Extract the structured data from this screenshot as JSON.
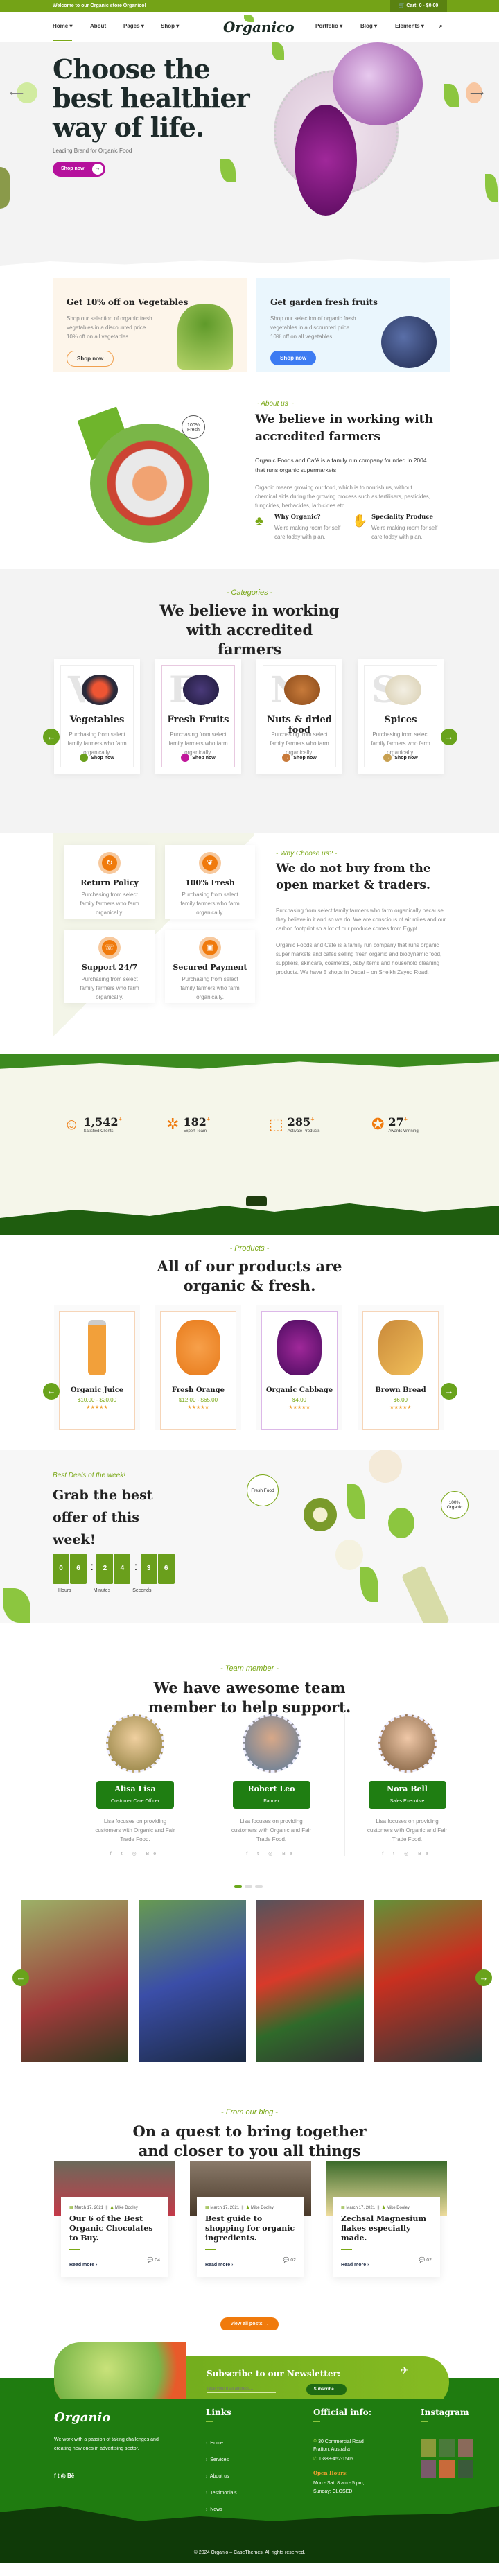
{
  "topbar": {
    "welcome": "Welcome to our Organic store Organico!",
    "cart": "Cart: 0 - $0.00",
    "cart_icon": "cart-icon"
  },
  "header": {
    "logo": "Organico",
    "nav_left": [
      "Home",
      "About",
      "Pages",
      "Shop"
    ],
    "nav_right": [
      "Portfolio",
      "Blog",
      "Elements"
    ],
    "dropdown": [
      "Home",
      "Pages",
      "Shop",
      "Portfolio",
      "Blog",
      "Elements"
    ],
    "active": "Home",
    "search_icon": "search-icon"
  },
  "hero": {
    "title": "Choose the best healthier way of life.",
    "subtitle": "Leading Brand for Organic Food",
    "cta": "Shop now",
    "prev_icon": "arrow-left-icon",
    "next_icon": "arrow-right-icon"
  },
  "promos": [
    {
      "title": "Get 10% off on Vegetables",
      "text": "Shop our selection of organic fresh vegetables in a discounted price. 10% off on all vegetables.",
      "button": "Shop now"
    },
    {
      "title": "Get garden fresh fruits",
      "text": "Shop our selection of organic fresh vegetables in a discounted price. 10% off on all vegetables.",
      "button": "Shop now"
    }
  ],
  "about": {
    "badge": "100% Fresh",
    "eyebrow": "~ About us ~",
    "title": "We believe in working with accredited farmers",
    "lead": "Organic Foods and Café is a family run company founded in 2004 that runs organic supermarkets",
    "text": "Organic means growing our food, which is to nourish us, without chemical aids during the growing process such as fertilisers, pesticides, fungcides, herbacides, larbicides etc",
    "features": [
      {
        "title": "Why Organic?",
        "text": "We're making room for self care today with plan."
      },
      {
        "title": "Speciality Produce",
        "text": "We're making room for self care today with plan."
      }
    ]
  },
  "categories": {
    "eyebrow": "- Categories -",
    "title": "We believe in working with accredited farmers",
    "items": [
      {
        "letter": "V",
        "name": "Vegetables",
        "text": "Purchasing from select family farmers who farm organically.",
        "cta": "Shop now",
        "color": "#6a9f1c"
      },
      {
        "letter": "F",
        "name": "Fresh Fruits",
        "text": "Purchasing from select family farmers who farm organically.",
        "cta": "Shop now",
        "color": "#c0189a"
      },
      {
        "letter": "N",
        "name": "Nuts & dried food",
        "text": "Purchasing from select family farmers who farm organically.",
        "cta": "Shop now",
        "color": "#c87a3a"
      },
      {
        "letter": "S",
        "name": "Spices",
        "text": "Purchasing from select family farmers who farm organically.",
        "cta": "Shop now",
        "color": "#c8a050"
      }
    ]
  },
  "why": {
    "eyebrow": "- Why Choose us? -",
    "title": "We do not buy from the open market & traders.",
    "p1": "Purchasing from select family farmers who farm organically because they believe in it and so we do. We are conscious of air miles and our carbon footprint so a lot of our produce comes from Egypt.",
    "p2": "Organic Foods and Café is a family run company that runs organic super markets and cafés selling fresh organic and biodynamic food, suppliers, skincare, cosmetics, baby items and household cleaning products. We have 5 shops in Dubai – on Sheikh Zayed Road.",
    "features": [
      {
        "title": "Return Policy",
        "text": "Purchasing from select family farmers who farm organically.",
        "icon": "refresh-icon"
      },
      {
        "title": "100% Fresh",
        "text": "Purchasing from select family farmers who farm organically.",
        "icon": "leaf-icon"
      },
      {
        "title": "Support 24/7",
        "text": "Purchasing from select family farmers who farm organically.",
        "icon": "headset-icon"
      },
      {
        "title": "Secured Payment",
        "text": "Purchasing from select family farmers who farm organically.",
        "icon": "card-check-icon"
      }
    ]
  },
  "counters": [
    {
      "value": "1,542",
      "label": "Satisfied Clients"
    },
    {
      "value": "182",
      "label": "Expert Team"
    },
    {
      "value": "285",
      "label": "Activate Products"
    },
    {
      "value": "27",
      "label": "Awards Winning"
    }
  ],
  "counter_suffix": "+",
  "products": {
    "eyebrow": "- Products -",
    "title": "All of our products are organic & fresh.",
    "items": [
      {
        "name": "Organic Juice",
        "price": "$10.00 - $20.00",
        "rating": 5
      },
      {
        "name": "Fresh Orange",
        "price": "$12.00 - $65.00",
        "rating": 5
      },
      {
        "name": "Organic Cabbage",
        "price": "$4.00",
        "rating": 5
      },
      {
        "name": "Brown Bread",
        "price": "$6.00",
        "rating": 5
      }
    ]
  },
  "deal": {
    "eyebrow": "Best Deals of the week!",
    "title": "Grab the best offer of this week!",
    "hours": "06",
    "minutes": "24",
    "seconds": "36",
    "labels": [
      "Hours",
      "Minutes",
      "Seconds"
    ],
    "badge1": "Fresh Food",
    "badge2": "100% Organic"
  },
  "team": {
    "eyebrow": "- Team member -",
    "title": "We have awesome team member to help support.",
    "members": [
      {
        "name": "Alisa Lisa",
        "role": "Customer Care Officer",
        "text": "Lisa focuses on providing customers with Organic and Fair Trade Food."
      },
      {
        "name": "Robert Leo",
        "role": "Farmer",
        "text": "Lisa focuses on providing customers with Organic and Fair Trade Food."
      },
      {
        "name": "Nora Bell",
        "role": "Sales Executive",
        "text": "Lisa focuses on providing customers with Organic and Fair Trade Food."
      }
    ],
    "social": "f  t  ◎  Bē",
    "active_slide": 1,
    "slides": 3
  },
  "blog": {
    "eyebrow": "- From our blog -",
    "title": "On a quest to bring together and closer to you all things Organic.",
    "posts": [
      {
        "date": "March 17, 2021",
        "author": "Mike Dooley",
        "title": "Our 6 of the Best Organic Chocolates to Buy.",
        "read": "Read more",
        "comments": "04"
      },
      {
        "date": "March 17, 2021",
        "author": "Mike Dooley",
        "title": "Best guide to shopping for organic ingredients.",
        "read": "Read more",
        "comments": "02"
      },
      {
        "date": "March 17, 2021",
        "author": "Mike Dooley",
        "title": "Zechsal Magnesium flakes especially made.",
        "read": "Read more",
        "comments": "02"
      }
    ],
    "view_all": "View all posts →"
  },
  "newsletter": {
    "title": "Subscribe to our Newsletter:",
    "placeholder": "Type your mail address...",
    "button": "Subscribe →"
  },
  "footer": {
    "logo": "Organio",
    "about": "We work with a passion of taking challenges and creating new ones in advertising sector.",
    "social": "f  t  ◎  Bē",
    "links_title": "Links",
    "links": [
      "Home",
      "Services",
      "About us",
      "Testimonials",
      "News"
    ],
    "info_title": "Official info:",
    "address": "30 Commercial Road Fratton, Australia",
    "phone": "1-888-452-1505",
    "hours_title": "Open Hours:",
    "hours1": "Mon - Sat: 8 am - 5 pm,",
    "hours2": "Sunday: CLOSED",
    "instagram_title": "Instagram",
    "copyright": "© 2024 Organio – CaseThemes. All rights reserved."
  },
  "colors": {
    "brand_green": "#74a317",
    "dark_green": "#1f7c10",
    "orange": "#f07a0c",
    "magenta": "#b5119c",
    "blue": "#3d7bf2"
  }
}
